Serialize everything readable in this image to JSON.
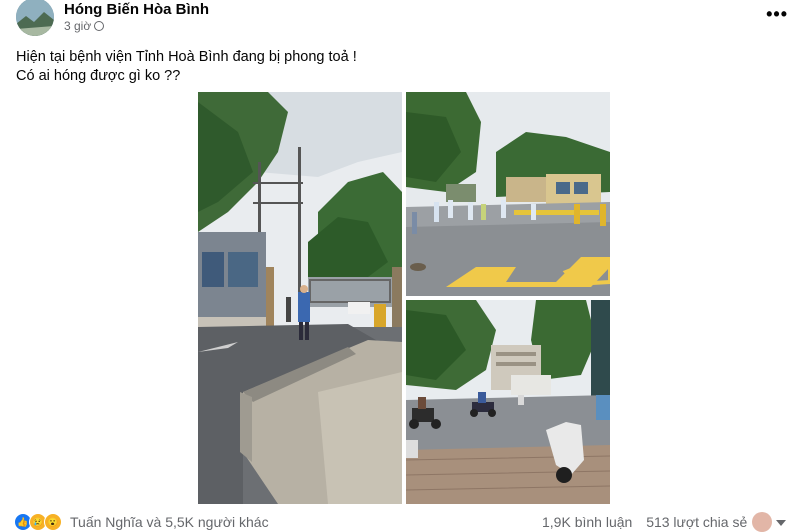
{
  "post": {
    "author": "Hóng Biến Hòa Bình",
    "time": "3 giờ",
    "more_icon": "more-horizontal-icon",
    "line1": "Hiện tại bệnh viện Tỉnh Hoà Bình đang bị phong toả !",
    "line2": "Có ai hóng được gì ko ??"
  },
  "reactions": {
    "icons": [
      "like-icon",
      "sad-icon",
      "wow-icon"
    ],
    "names": "Tuấn Nghĩa và 5,5K người khác"
  },
  "stats": {
    "comments": "1,9K bình luận",
    "shares": "513 lượt chia sẻ"
  },
  "colors": {
    "accent": "#1877f2",
    "secondary_text": "#65676b"
  }
}
